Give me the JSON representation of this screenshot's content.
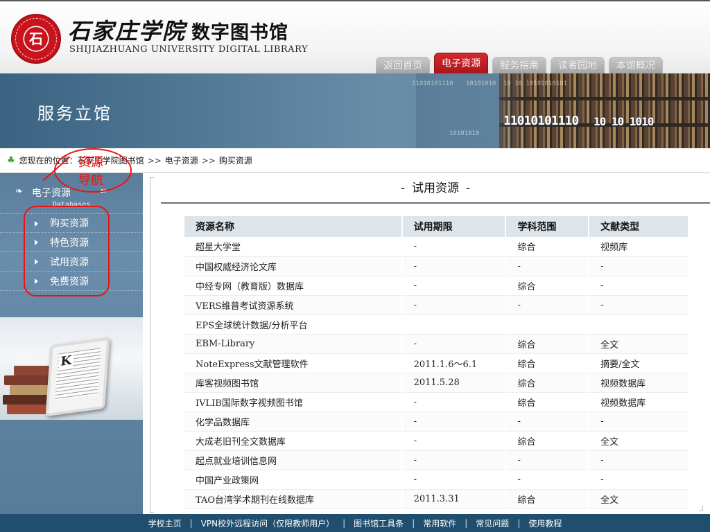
{
  "header": {
    "logo_text": "石家庄学院",
    "title_cn_1": "石家庄学院",
    "title_cn_2": "数字图书馆",
    "title_en": "SHIJIAZHUANG UNIVERSITY DIGITAL LIBRARY",
    "nav_tabs": [
      {
        "label": "返回首页",
        "active": false
      },
      {
        "label": "电子资源",
        "active": true
      },
      {
        "label": "服务指南",
        "active": false
      },
      {
        "label": "读者园地",
        "active": false
      },
      {
        "label": "本馆概况",
        "active": false
      }
    ]
  },
  "banner": {
    "title": "服务立馆",
    "binary_strings": [
      "11010101110",
      "10101010",
      "10 10 10101010101",
      "11010101110",
      "10101010",
      "10 10 1010"
    ]
  },
  "breadcrumb": {
    "prefix": "您现在的位置：",
    "items": [
      "石家庄学院图书馆",
      "电子资源",
      "购买资源"
    ],
    "separator": ">>"
  },
  "sidebar": {
    "title": "电子资源",
    "subtitle": "Databases",
    "items": [
      {
        "label": "购买资源"
      },
      {
        "label": "特色资源"
      },
      {
        "label": "试用资源"
      },
      {
        "label": "免费资源"
      }
    ]
  },
  "annotation": {
    "text": "资源导航",
    "color": "#e11111"
  },
  "main": {
    "section_title": "试用资源",
    "table": {
      "headers": [
        "资源名称",
        "试用期限",
        "学科范围",
        "文献类型"
      ],
      "rows": [
        [
          "超星大学堂",
          "-",
          "综合",
          "视频库"
        ],
        [
          "中国权威经济论文库",
          "-",
          "-",
          "-"
        ],
        [
          "中经专网（教育版）数据库",
          "-",
          "综合",
          "-"
        ],
        [
          "VERS维普考试资源系统",
          "-",
          "-",
          "-"
        ],
        [
          "EPS全球统计数据/分析平台",
          "",
          "",
          ""
        ],
        [
          "EBM-Library",
          "-",
          "综合",
          "全文"
        ],
        [
          "NoteExpress文献管理软件",
          "2011.1.6～6.1",
          "综合",
          "摘要/全文"
        ],
        [
          "库客视频图书馆",
          "2011.5.28",
          "综合",
          "视频数据库"
        ],
        [
          "IVLIB国际数字视频图书馆",
          "-",
          "综合",
          "视频数据库"
        ],
        [
          "化学品数据库",
          "-",
          "-",
          "-"
        ],
        [
          "大成老旧刊全文数据库",
          "-",
          "综合",
          "全文"
        ],
        [
          "起点就业培训信息网",
          "-",
          "-",
          "-"
        ],
        [
          "中国产业政策网",
          "-",
          "-",
          "-"
        ],
        [
          "TAO台湾学术期刊在线数据库",
          "2011.3.31",
          "综合",
          "全文"
        ]
      ]
    }
  },
  "footer": {
    "links": [
      "学校主页",
      "VPN校外远程访问（仅限教师用户）",
      "图书馆工具条",
      "常用软件",
      "常见问题",
      "使用教程"
    ],
    "separator": "|"
  },
  "colors": {
    "accent_red": "#c8141c",
    "banner_blue": "#537a96",
    "sidebar_blue": "#6a8dab",
    "footer_blue": "#1f4e6e",
    "table_header": "#dde4ea"
  }
}
